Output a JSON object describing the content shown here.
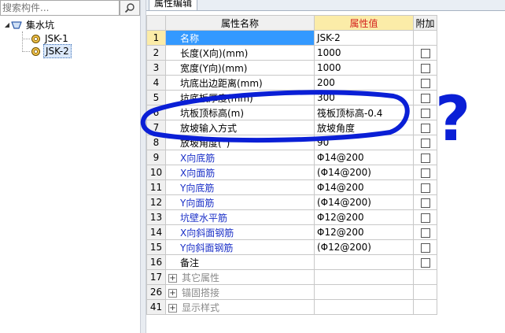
{
  "search": {
    "placeholder": "搜索构件..."
  },
  "tree": {
    "root": "集水坑",
    "children": [
      "JSK-1",
      "JSK-2"
    ]
  },
  "tabs": {
    "properties": "属性编辑"
  },
  "grid": {
    "headers": {
      "name": "属性名称",
      "value": "属性值",
      "extra": "附加"
    },
    "rows": [
      {
        "num": "1",
        "name": "名称",
        "value": "JSK-2",
        "check": false
      },
      {
        "num": "2",
        "name": "长度(X向)(mm)",
        "value": "1000",
        "check": true
      },
      {
        "num": "3",
        "name": "宽度(Y向)(mm)",
        "value": "1000",
        "check": true
      },
      {
        "num": "4",
        "name": "坑底出边距离(mm)",
        "value": "200",
        "check": true
      },
      {
        "num": "5",
        "name": "坑底板厚度(mm)",
        "value": "300",
        "check": true
      },
      {
        "num": "6",
        "name": "坑板顶标高(m)",
        "value": "筏板顶标高-0.4",
        "check": true
      },
      {
        "num": "7",
        "name": "放坡输入方式",
        "value": "放坡角度",
        "check": true
      },
      {
        "num": "8",
        "name": "放坡角度(°)",
        "value": "90",
        "check": true
      },
      {
        "num": "9",
        "name": "X向底筋",
        "value": "Φ14@200",
        "check": true
      },
      {
        "num": "10",
        "name": "X向面筋",
        "value": "(Φ14@200)",
        "check": true
      },
      {
        "num": "11",
        "name": "Y向底筋",
        "value": "Φ14@200",
        "check": true
      },
      {
        "num": "12",
        "name": "Y向面筋",
        "value": "(Φ14@200)",
        "check": true
      },
      {
        "num": "13",
        "name": "坑壁水平筋",
        "value": "Φ12@200",
        "check": true
      },
      {
        "num": "14",
        "name": "X向斜面钢筋",
        "value": "Φ12@200",
        "check": true
      },
      {
        "num": "15",
        "name": "Y向斜面钢筋",
        "value": "(Φ12@200)",
        "check": true
      },
      {
        "num": "16",
        "name": "备注",
        "value": "",
        "check": true
      },
      {
        "num": "17",
        "name": "其它属性",
        "value": "",
        "check": false
      },
      {
        "num": "26",
        "name": "锚固搭接",
        "value": "",
        "check": false
      },
      {
        "num": "41",
        "name": "显示样式",
        "value": "",
        "check": false
      }
    ],
    "group_expander": "+"
  },
  "annotation": {
    "mark": "?",
    "color": "#0a1fd6"
  }
}
